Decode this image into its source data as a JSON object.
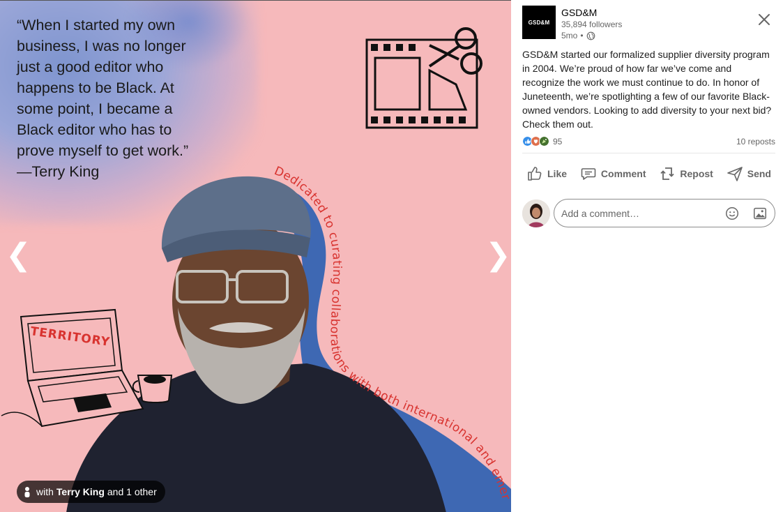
{
  "media": {
    "quote_text": "“When I started my own\nbusiness, I was no longer\njust a good editor who\nhappens to be Black. At\nsome point, I became a\nBlack editor who has to\nprove myself to get work.”\n—Terry King",
    "curved_caption": "Dedicated to curating collaborations with both international and emerging talent",
    "laptop_label": "TERRITORY",
    "prev_arrow": "❮",
    "next_arrow": "❯",
    "tag": {
      "prefix": "with",
      "name": "Terry King",
      "suffix": "and 1 other"
    },
    "colors": {
      "background": "#f6b9bb",
      "stripe": "#3e68b3",
      "caption": "#d8332f"
    }
  },
  "post": {
    "author": "GSD&M",
    "logo_text": "GSD&M",
    "followers": "35,894 followers",
    "time": "5mo",
    "visibility_icon": "globe-icon",
    "body": "GSD&M started our formalized supplier diversity program in 2004. We’re proud of how far we’ve come and recognize the work we must continue to do. In honor of Juneteenth, we’re spotlighting a few of our favorite Black-owned vendors. Looking to add diversity to your next bid? Check them out.",
    "reaction_count": "95",
    "reposts": "10 reposts",
    "actions": {
      "like": "Like",
      "comment": "Comment",
      "repost": "Repost",
      "send": "Send"
    },
    "comment_placeholder": "Add a comment…"
  }
}
